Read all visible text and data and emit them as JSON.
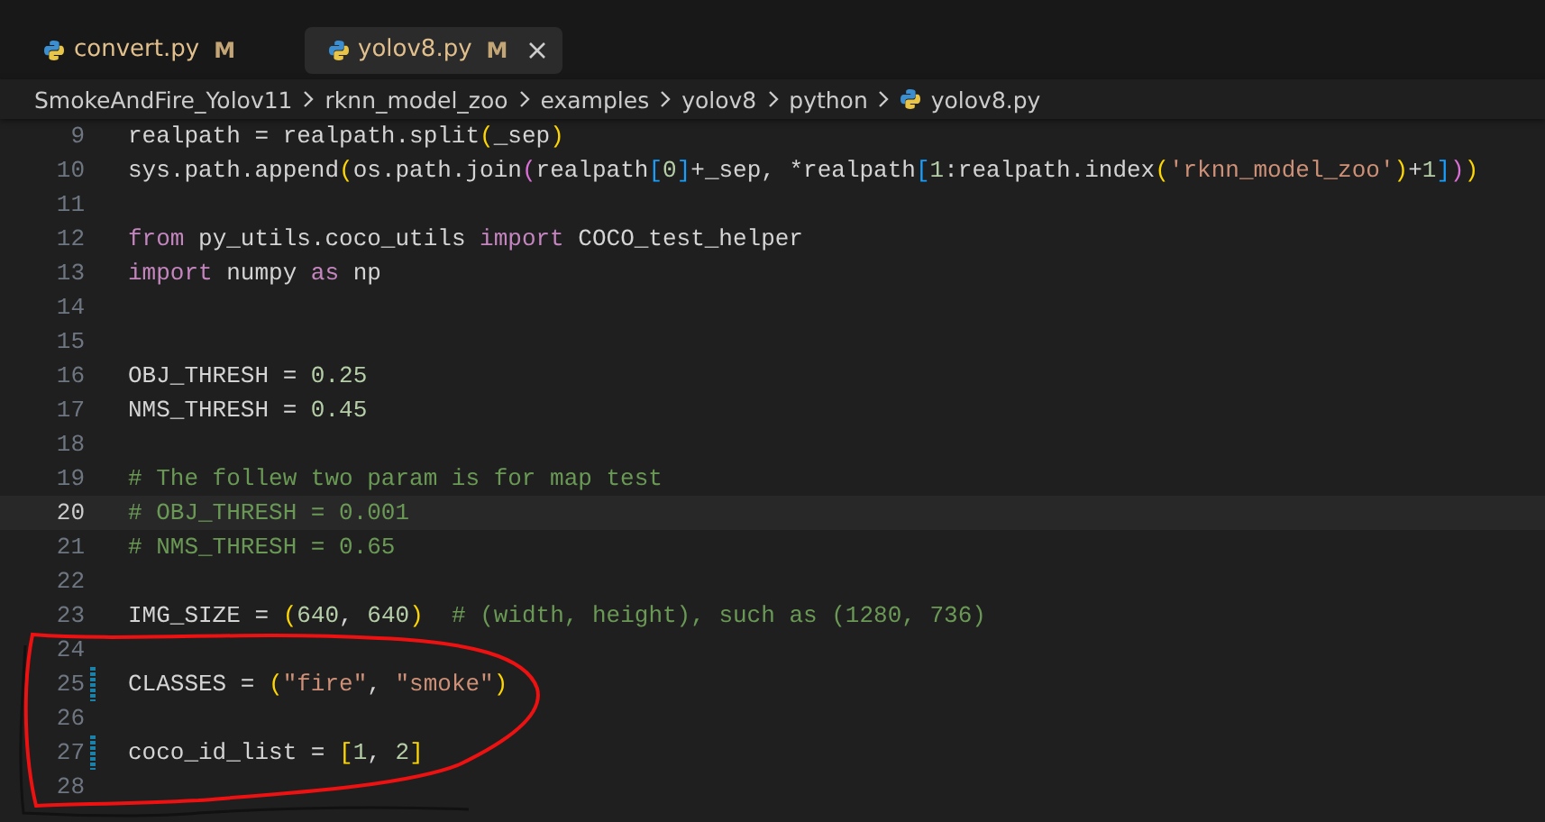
{
  "tabs": [
    {
      "label": "convert.py",
      "badge": "M",
      "selected": false
    },
    {
      "label": "yolov8.py",
      "badge": "M",
      "selected": true
    }
  ],
  "breadcrumb": [
    {
      "label": "SmokeAndFire_Yolov11",
      "kind": "folder"
    },
    {
      "label": "rknn_model_zoo",
      "kind": "folder"
    },
    {
      "label": "examples",
      "kind": "folder"
    },
    {
      "label": "yolov8",
      "kind": "folder"
    },
    {
      "label": "python",
      "kind": "folder"
    },
    {
      "label": "yolov8.py",
      "kind": "file"
    }
  ],
  "editor": {
    "lines": [
      {
        "number": "9",
        "current": false,
        "modified": false,
        "tokens": [
          {
            "kind": "plain",
            "text": "realpath = realpath.split"
          },
          {
            "kind": "bracket1",
            "text": "("
          },
          {
            "kind": "plain",
            "text": "_sep"
          },
          {
            "kind": "bracket1",
            "text": ")"
          }
        ]
      },
      {
        "number": "10",
        "current": false,
        "modified": false,
        "tokens": [
          {
            "kind": "plain",
            "text": "sys.path.append"
          },
          {
            "kind": "bracket1",
            "text": "("
          },
          {
            "kind": "plain",
            "text": "os.path.join"
          },
          {
            "kind": "bracket2",
            "text": "("
          },
          {
            "kind": "plain",
            "text": "realpath"
          },
          {
            "kind": "bracket3",
            "text": "["
          },
          {
            "kind": "number",
            "text": "0"
          },
          {
            "kind": "bracket3",
            "text": "]"
          },
          {
            "kind": "plain",
            "text": "+_sep, *realpath"
          },
          {
            "kind": "bracket3",
            "text": "["
          },
          {
            "kind": "number",
            "text": "1"
          },
          {
            "kind": "plain",
            "text": ":realpath.index"
          },
          {
            "kind": "bracket1",
            "text": "("
          },
          {
            "kind": "string",
            "text": "'rknn_model_zoo'"
          },
          {
            "kind": "bracket1",
            "text": ")"
          },
          {
            "kind": "plain",
            "text": "+"
          },
          {
            "kind": "number",
            "text": "1"
          },
          {
            "kind": "bracket3",
            "text": "]"
          },
          {
            "kind": "bracket2",
            "text": ")"
          },
          {
            "kind": "bracket1",
            "text": ")"
          }
        ]
      },
      {
        "number": "11",
        "current": false,
        "modified": false
      },
      {
        "number": "12",
        "current": false,
        "modified": false,
        "tokens": [
          {
            "kind": "keyword",
            "text": "from"
          },
          {
            "kind": "plain",
            "text": " py_utils.coco_utils "
          },
          {
            "kind": "keyword",
            "text": "import"
          },
          {
            "kind": "plain",
            "text": " COCO_test_helper"
          }
        ]
      },
      {
        "number": "13",
        "current": false,
        "modified": false,
        "tokens": [
          {
            "kind": "keyword",
            "text": "import"
          },
          {
            "kind": "plain",
            "text": " numpy "
          },
          {
            "kind": "keyword",
            "text": "as"
          },
          {
            "kind": "plain",
            "text": " np"
          }
        ]
      },
      {
        "number": "14",
        "current": false,
        "modified": false
      },
      {
        "number": "15",
        "current": false,
        "modified": false
      },
      {
        "number": "16",
        "current": false,
        "modified": false,
        "tokens": [
          {
            "kind": "plain",
            "text": "OBJ_THRESH = "
          },
          {
            "kind": "number",
            "text": "0.25"
          }
        ]
      },
      {
        "number": "17",
        "current": false,
        "modified": false,
        "tokens": [
          {
            "kind": "plain",
            "text": "NMS_THRESH = "
          },
          {
            "kind": "number",
            "text": "0.45"
          }
        ]
      },
      {
        "number": "18",
        "current": false,
        "modified": false
      },
      {
        "number": "19",
        "current": false,
        "modified": false,
        "tokens": [
          {
            "kind": "comment",
            "text": "# The follew two param is for map test"
          }
        ]
      },
      {
        "number": "20",
        "current": true,
        "modified": false,
        "tokens": [
          {
            "kind": "comment",
            "text": "# OBJ_THRESH = 0.001"
          }
        ]
      },
      {
        "number": "21",
        "current": false,
        "modified": false,
        "tokens": [
          {
            "kind": "comment",
            "text": "# NMS_THRESH = 0.65"
          }
        ]
      },
      {
        "number": "22",
        "current": false,
        "modified": false
      },
      {
        "number": "23",
        "current": false,
        "modified": false,
        "tokens": [
          {
            "kind": "plain",
            "text": "IMG_SIZE = "
          },
          {
            "kind": "bracket1",
            "text": "("
          },
          {
            "kind": "number",
            "text": "640"
          },
          {
            "kind": "plain",
            "text": ", "
          },
          {
            "kind": "number",
            "text": "640"
          },
          {
            "kind": "bracket1",
            "text": ")"
          },
          {
            "kind": "comment",
            "text": "  # (width, height), such as (1280, 736)"
          }
        ]
      },
      {
        "number": "24",
        "current": false,
        "modified": false
      },
      {
        "number": "25",
        "current": false,
        "modified": true,
        "tokens": [
          {
            "kind": "plain",
            "text": "CLASSES = "
          },
          {
            "kind": "bracket1",
            "text": "("
          },
          {
            "kind": "string",
            "text": "\"fire\""
          },
          {
            "kind": "plain",
            "text": ", "
          },
          {
            "kind": "string",
            "text": "\"smoke\""
          },
          {
            "kind": "bracket1",
            "text": ")"
          }
        ]
      },
      {
        "number": "26",
        "current": false,
        "modified": false
      },
      {
        "number": "27",
        "current": false,
        "modified": true,
        "tokens": [
          {
            "kind": "plain",
            "text": "coco_id_list = "
          },
          {
            "kind": "bracket1",
            "text": "["
          },
          {
            "kind": "number",
            "text": "1"
          },
          {
            "kind": "plain",
            "text": ", "
          },
          {
            "kind": "number",
            "text": "2"
          },
          {
            "kind": "bracket1",
            "text": "]"
          }
        ]
      },
      {
        "number": "28",
        "current": false,
        "modified": false
      }
    ]
  }
}
